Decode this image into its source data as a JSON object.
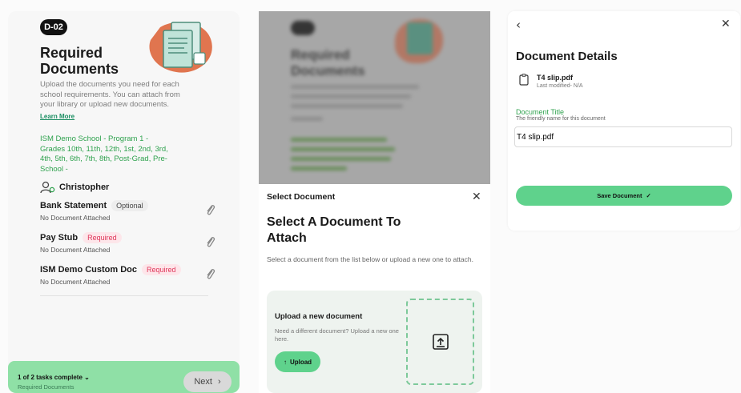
{
  "colors": {
    "accent_green": "#5fd28c",
    "required_red": "#e0365a",
    "link_green": "#2fa24e",
    "footer_green": "#8fe0a6"
  },
  "panel1": {
    "badge": "D-02",
    "title": "Required Documents",
    "description": "Upload the documents you need for each school requirements. You can attach from your library or upload new documents.",
    "learn_more": "Learn More",
    "school": "ISM Demo School - Program 1 - Grades 10th, 11th, 12th, 1st, 2nd, 3rd, 4th, 5th, 6th, 7th, 8th, Post-Grad, Pre-School -",
    "person": "Christopher",
    "documents": [
      {
        "name": "Bank Statement",
        "tag": "Optional",
        "status": "No Document Attached"
      },
      {
        "name": "Pay Stub",
        "tag": "Required",
        "status": "No Document Attached"
      },
      {
        "name": "ISM Demo Custom Doc",
        "tag": "Required",
        "status": "No Document Attached"
      }
    ],
    "footer_tasks": "1 of 2 tasks complete",
    "footer_sub": "Required Documents",
    "next_label": "Next",
    "icons": {
      "person": "person-gear-icon",
      "attach": "paperclip-icon",
      "chevron": "chevron-down-icon",
      "next": "chevron-right-icon"
    }
  },
  "panel2": {
    "sheet_title": "Select Document",
    "heading": "Select A Document To Attach",
    "description": "Select a document from the list below or upload a new one to attach.",
    "upload_title": "Upload a new document",
    "upload_desc": "Need a different document? Upload a new one here.",
    "upload_button": "Upload",
    "close": "✕"
  },
  "panel3": {
    "back": "‹",
    "close": "✕",
    "title": "Document Details",
    "file_name": "T4 slip.pdf",
    "file_meta": "Last modified- N/A",
    "field_label": "Document Title",
    "field_sub": "The friendly name for this document",
    "field_value": "T4 slip.pdf",
    "save_label": "Save Document"
  }
}
